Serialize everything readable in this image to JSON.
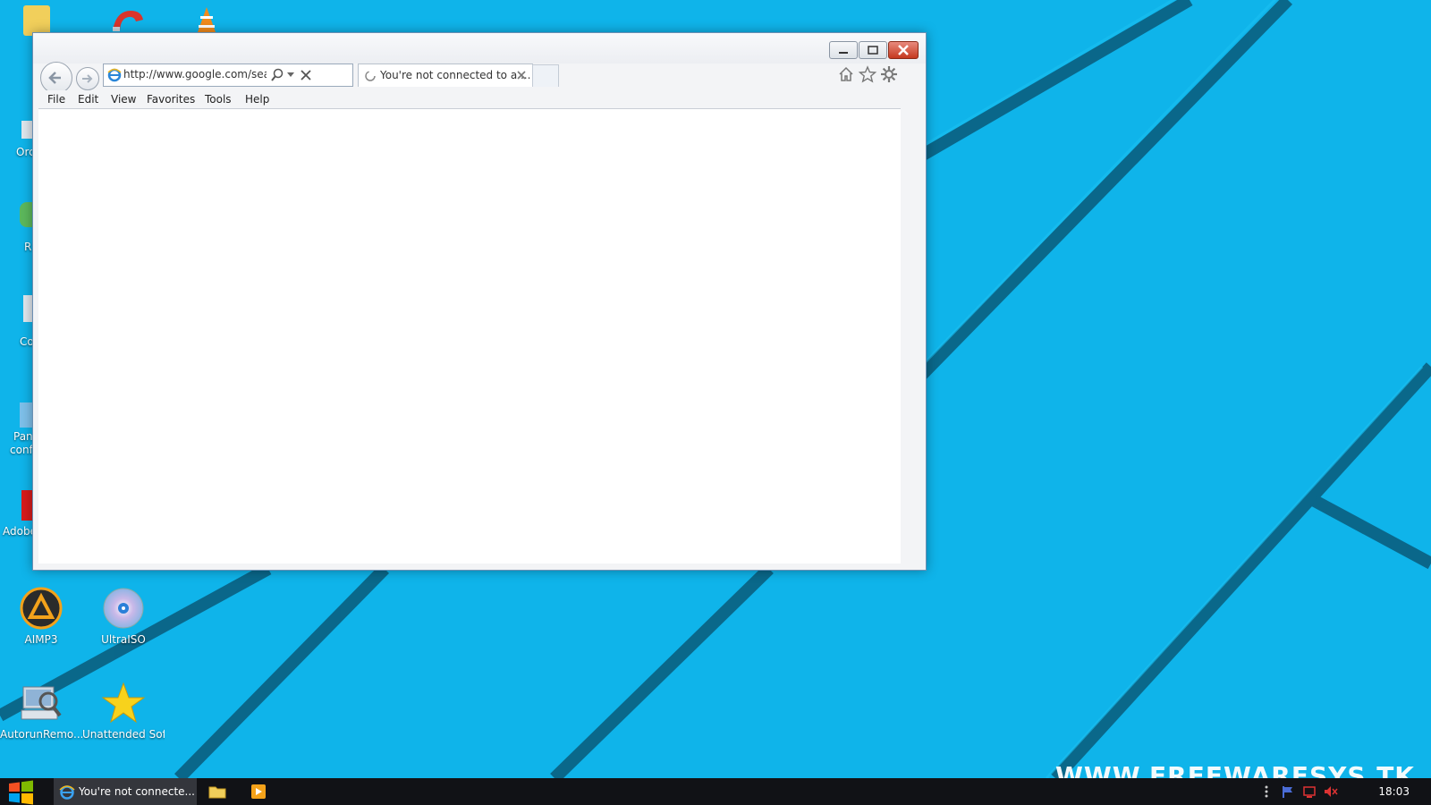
{
  "desktop": {
    "icons": {
      "aimp": "AIMP3",
      "ultraiso": "UltraISO",
      "autorun": "AutorunRemo...",
      "unattended": "Unattended Soft"
    },
    "partial_labels": {
      "ord": "Orc",
      "r": "R",
      "co": "Co",
      "pan": "Pan",
      "conf": "conf",
      "adobe": "Adobe"
    },
    "watermark": "WWW.FREEWARESYS.TK"
  },
  "browser": {
    "address": "http://www.google.com/search",
    "tab_label": "You're not connected to a ...",
    "menu": [
      "File",
      "Edit",
      "View",
      "Favorites",
      "Tools",
      "Help"
    ]
  },
  "taskbar": {
    "ie_label": "You're not connecte...",
    "clock": "18:03"
  },
  "colors": {
    "wallpaper": "#0fb4ea",
    "wallpaper_stripe": "#0b6f94",
    "taskbar": "#111216"
  },
  "icon_names": [
    "start-icon",
    "ie-icon",
    "folder-icon",
    "media-player-icon",
    "home-icon",
    "star-icon",
    "gear-icon"
  ]
}
